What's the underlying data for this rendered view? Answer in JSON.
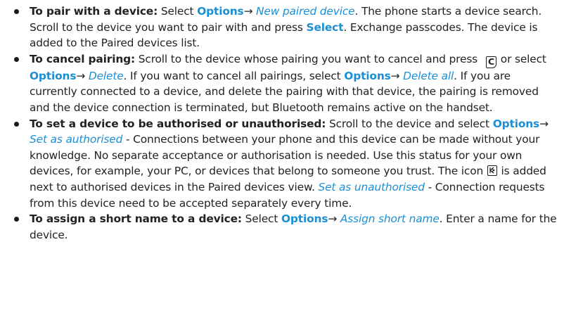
{
  "items": [
    {
      "lead": "To pair with a device:",
      "t1": " Select ",
      "o1": "Options",
      "arrow1": "→",
      "i1": " New paired device",
      "t2": ". The phone starts a device search. Scroll to the device you want to pair with and press ",
      "o2": "Select",
      "t3": ". Exchange passcodes. The device is added to the Paired devices list."
    },
    {
      "lead": "To cancel pairing:",
      "t1": " Scroll to the device whose pairing you want to cancel and press",
      "key": "C",
      "t2": " or select ",
      "o1": "Options",
      "arrow1": "→",
      "i1": " Delete",
      "t3": ". If you want to cancel all pairings, select ",
      "o2": "Options",
      "arrow2": "→",
      "i2": " Delete all",
      "t4": ". If you are currently connected to a device, and delete the pairing with that device, the pairing is removed and the device connection is terminated, but Bluetooth remains active on the handset."
    },
    {
      "lead": "To set a device to be authorised or unauthorised:",
      "t1": " Scroll to the device and select ",
      "o1": "Options",
      "arrow1": "→",
      "i1": " Set as authorised",
      "t2": " - Connections between your phone and this device can be made without your knowledge. No separate acceptance or authorisation is needed. Use this status for your own devices, for example, your PC, or devices that belong to someone you trust. The icon ",
      "t3": " is added next to authorised devices in the Paired devices view. ",
      "i2": "Set as unauthorised",
      "t4": " - Connection requests from this device need to be accepted separately every time."
    },
    {
      "lead": "To assign a short name to a device:",
      "t1": " Select ",
      "o1": "Options",
      "arrow1": "→",
      "i1": " Assign short name",
      "t2": ". Enter a name for the device."
    }
  ],
  "icons": {
    "bullet": "bullet-dot",
    "clear_key": "clear-key-icon",
    "authorised": "authorised-device-icon"
  },
  "colors": {
    "text": "#222222",
    "accent": "#1a8fd6"
  }
}
